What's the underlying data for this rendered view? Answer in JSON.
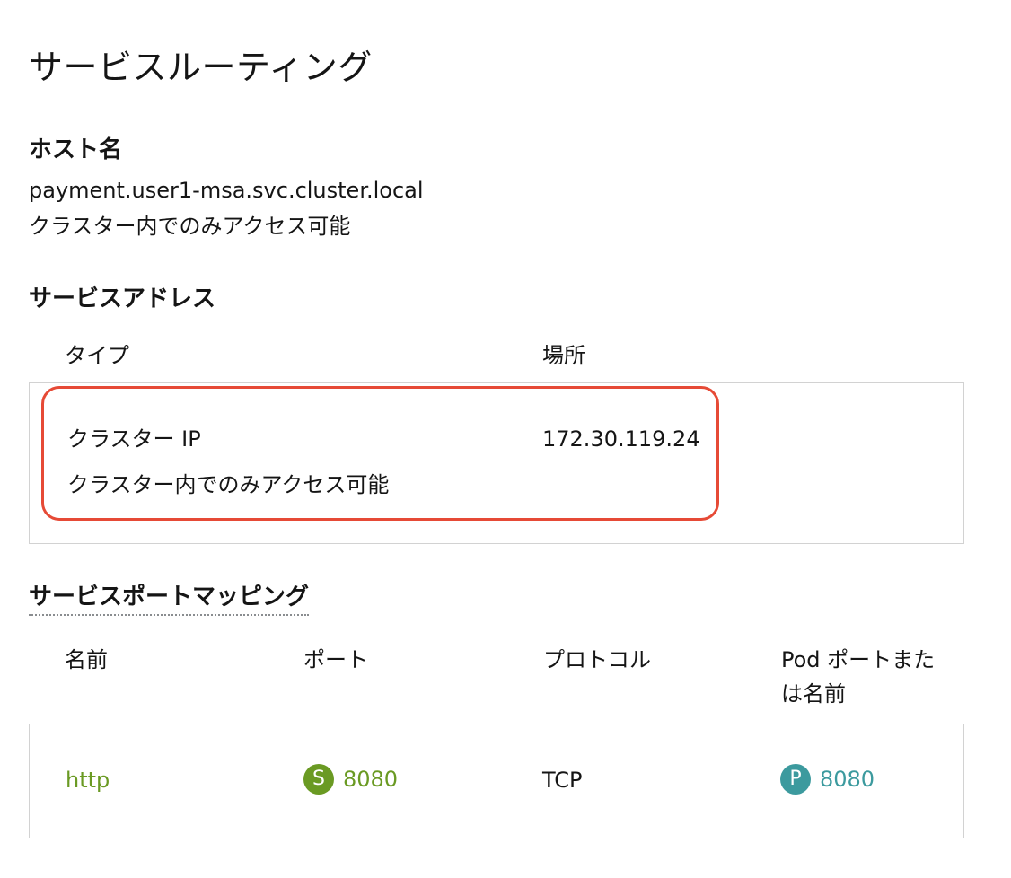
{
  "page_title": "サービスルーティング",
  "hostname": {
    "heading": "ホスト名",
    "value": "payment.user1-msa.svc.cluster.local",
    "note": "クラスター内でのみアクセス可能"
  },
  "service_address": {
    "heading": "サービスアドレス",
    "col_type": "タイプ",
    "col_location": "場所",
    "row": {
      "type": "クラスター IP",
      "type_note": "クラスター内でのみアクセス可能",
      "location": "172.30.119.24"
    }
  },
  "port_mapping": {
    "heading": "サービスポートマッピング",
    "col_name": "名前",
    "col_port": "ポート",
    "col_protocol": "プロトコル",
    "col_pod_port_line1": "Pod ポートまた",
    "col_pod_port_line2": "は名前",
    "row": {
      "name": "http",
      "port_badge": "S",
      "port": "8080",
      "protocol": "TCP",
      "pod_badge": "P",
      "pod_port": "8080"
    }
  },
  "colors": {
    "link_green": "#6a9a23",
    "service_badge": "#6a9a23",
    "pod_badge": "#3c9a9e",
    "highlight": "#e64a36"
  }
}
